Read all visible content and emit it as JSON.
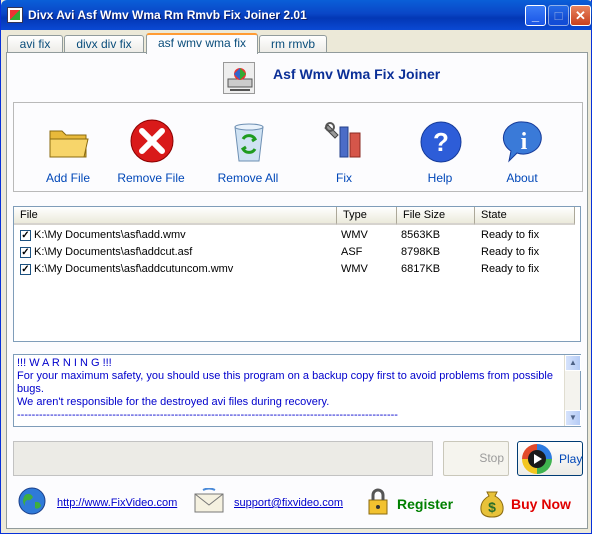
{
  "window": {
    "title": "Divx Avi Asf Wmv Wma Rm Rmvb Fix Joiner 2.01"
  },
  "tabs": [
    {
      "label": "avi fix"
    },
    {
      "label": "divx div fix"
    },
    {
      "label": "asf wmv wma fix"
    },
    {
      "label": "rm rmvb"
    }
  ],
  "header": {
    "title": "Asf Wmv Wma Fix Joiner"
  },
  "toolbar": {
    "add": "Add File",
    "remove": "Remove File",
    "remove_all": "Remove All",
    "fix": "Fix",
    "help": "Help",
    "about": "About"
  },
  "list": {
    "columns": [
      "File",
      "Type",
      "File Size",
      "State"
    ],
    "rows": [
      {
        "checked": true,
        "file": "K:\\My Documents\\asf\\add.wmv",
        "type": "WMV",
        "size": "8563KB",
        "state": "Ready to fix"
      },
      {
        "checked": true,
        "file": "K:\\My Documents\\asf\\addcut.asf",
        "type": "ASF",
        "size": "8798KB",
        "state": "Ready to fix"
      },
      {
        "checked": true,
        "file": "K:\\My Documents\\asf\\addcutuncom.wmv",
        "type": "WMV",
        "size": "6817KB",
        "state": "Ready to fix"
      }
    ]
  },
  "memo": {
    "line1": "!!! W A R N I N G !!!",
    "line2": "For your maximum safety, you should use this program on a backup copy first to avoid problems from possible bugs.",
    "line3": "We aren't responsible for the destroyed avi files during recovery.",
    "line4": "--------------------------------------------------------------------------------------------------------"
  },
  "buttons": {
    "stop": "Stop",
    "play": "Play"
  },
  "footer": {
    "website": "http://www.FixVideo.com",
    "email": "support@fixvideo.com",
    "register": "Register",
    "buy": "Buy Now"
  },
  "colors": {
    "accent": "#0047b8",
    "title_blue": "#0b2f97",
    "register": "#008000",
    "buy": "#e00000"
  }
}
